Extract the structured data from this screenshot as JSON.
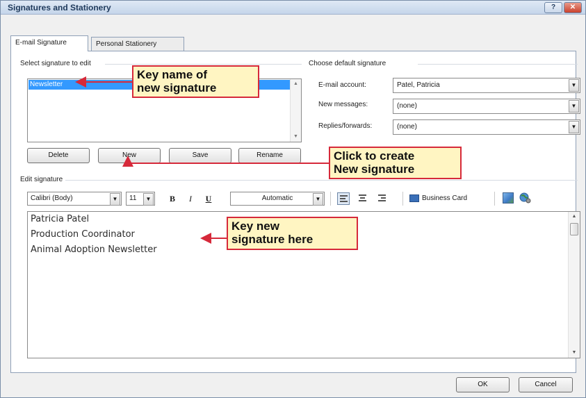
{
  "window": {
    "title": "Signatures and Stationery",
    "help_glyph": "?",
    "close_glyph": "✕"
  },
  "tabs": [
    {
      "label": "E-mail Signature",
      "active": true
    },
    {
      "label": "Personal Stationery",
      "active": false
    }
  ],
  "select_signature": {
    "group_label": "Select signature to edit",
    "items": [
      "Newsletter"
    ],
    "selected": "Newsletter",
    "buttons": {
      "delete": "Delete",
      "new": "New",
      "save": "Save",
      "rename": "Rename"
    }
  },
  "default_signature": {
    "group_label": "Choose default signature",
    "email_account": {
      "label": "E-mail account:",
      "value": "Patel, Patricia"
    },
    "new_messages": {
      "label": "New messages:",
      "value": "(none)"
    },
    "replies_forwards": {
      "label": "Replies/forwards:",
      "value": "(none)"
    }
  },
  "edit_signature": {
    "group_label": "Edit signature",
    "toolbar": {
      "font": "Calibri (Body)",
      "size": "11",
      "bold": "B",
      "italic": "I",
      "underline": "U",
      "color": "Automatic",
      "business_card": "Business Card"
    },
    "lines": [
      "Patricia Patel",
      "Production Coordinator",
      "Animal Adoption Newsletter"
    ]
  },
  "dialog_buttons": {
    "ok": "OK",
    "cancel": "Cancel"
  },
  "callouts": {
    "name": [
      "Key name of",
      "new signature"
    ],
    "create": [
      "Click to create",
      "New signature"
    ],
    "key": [
      "Key new",
      "signature here"
    ]
  },
  "colors": {
    "callout_border": "#d6293a",
    "callout_fill": "#fff5c2",
    "selection": "#3399ff"
  }
}
